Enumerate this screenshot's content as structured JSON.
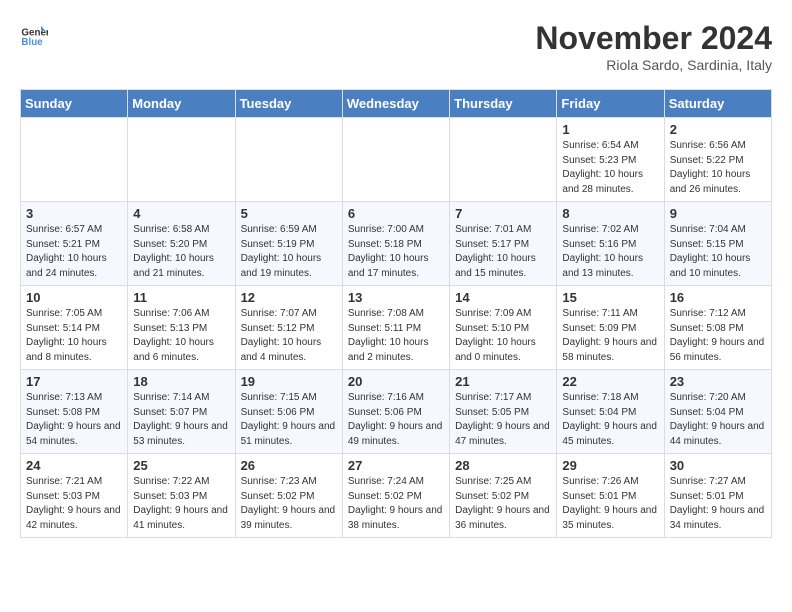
{
  "header": {
    "logo_line1": "General",
    "logo_line2": "Blue",
    "month_year": "November 2024",
    "location": "Riola Sardo, Sardinia, Italy"
  },
  "weekdays": [
    "Sunday",
    "Monday",
    "Tuesday",
    "Wednesday",
    "Thursday",
    "Friday",
    "Saturday"
  ],
  "weeks": [
    [
      {
        "day": "",
        "info": ""
      },
      {
        "day": "",
        "info": ""
      },
      {
        "day": "",
        "info": ""
      },
      {
        "day": "",
        "info": ""
      },
      {
        "day": "",
        "info": ""
      },
      {
        "day": "1",
        "info": "Sunrise: 6:54 AM\nSunset: 5:23 PM\nDaylight: 10 hours and 28 minutes."
      },
      {
        "day": "2",
        "info": "Sunrise: 6:56 AM\nSunset: 5:22 PM\nDaylight: 10 hours and 26 minutes."
      }
    ],
    [
      {
        "day": "3",
        "info": "Sunrise: 6:57 AM\nSunset: 5:21 PM\nDaylight: 10 hours and 24 minutes."
      },
      {
        "day": "4",
        "info": "Sunrise: 6:58 AM\nSunset: 5:20 PM\nDaylight: 10 hours and 21 minutes."
      },
      {
        "day": "5",
        "info": "Sunrise: 6:59 AM\nSunset: 5:19 PM\nDaylight: 10 hours and 19 minutes."
      },
      {
        "day": "6",
        "info": "Sunrise: 7:00 AM\nSunset: 5:18 PM\nDaylight: 10 hours and 17 minutes."
      },
      {
        "day": "7",
        "info": "Sunrise: 7:01 AM\nSunset: 5:17 PM\nDaylight: 10 hours and 15 minutes."
      },
      {
        "day": "8",
        "info": "Sunrise: 7:02 AM\nSunset: 5:16 PM\nDaylight: 10 hours and 13 minutes."
      },
      {
        "day": "9",
        "info": "Sunrise: 7:04 AM\nSunset: 5:15 PM\nDaylight: 10 hours and 10 minutes."
      }
    ],
    [
      {
        "day": "10",
        "info": "Sunrise: 7:05 AM\nSunset: 5:14 PM\nDaylight: 10 hours and 8 minutes."
      },
      {
        "day": "11",
        "info": "Sunrise: 7:06 AM\nSunset: 5:13 PM\nDaylight: 10 hours and 6 minutes."
      },
      {
        "day": "12",
        "info": "Sunrise: 7:07 AM\nSunset: 5:12 PM\nDaylight: 10 hours and 4 minutes."
      },
      {
        "day": "13",
        "info": "Sunrise: 7:08 AM\nSunset: 5:11 PM\nDaylight: 10 hours and 2 minutes."
      },
      {
        "day": "14",
        "info": "Sunrise: 7:09 AM\nSunset: 5:10 PM\nDaylight: 10 hours and 0 minutes."
      },
      {
        "day": "15",
        "info": "Sunrise: 7:11 AM\nSunset: 5:09 PM\nDaylight: 9 hours and 58 minutes."
      },
      {
        "day": "16",
        "info": "Sunrise: 7:12 AM\nSunset: 5:08 PM\nDaylight: 9 hours and 56 minutes."
      }
    ],
    [
      {
        "day": "17",
        "info": "Sunrise: 7:13 AM\nSunset: 5:08 PM\nDaylight: 9 hours and 54 minutes."
      },
      {
        "day": "18",
        "info": "Sunrise: 7:14 AM\nSunset: 5:07 PM\nDaylight: 9 hours and 53 minutes."
      },
      {
        "day": "19",
        "info": "Sunrise: 7:15 AM\nSunset: 5:06 PM\nDaylight: 9 hours and 51 minutes."
      },
      {
        "day": "20",
        "info": "Sunrise: 7:16 AM\nSunset: 5:06 PM\nDaylight: 9 hours and 49 minutes."
      },
      {
        "day": "21",
        "info": "Sunrise: 7:17 AM\nSunset: 5:05 PM\nDaylight: 9 hours and 47 minutes."
      },
      {
        "day": "22",
        "info": "Sunrise: 7:18 AM\nSunset: 5:04 PM\nDaylight: 9 hours and 45 minutes."
      },
      {
        "day": "23",
        "info": "Sunrise: 7:20 AM\nSunset: 5:04 PM\nDaylight: 9 hours and 44 minutes."
      }
    ],
    [
      {
        "day": "24",
        "info": "Sunrise: 7:21 AM\nSunset: 5:03 PM\nDaylight: 9 hours and 42 minutes."
      },
      {
        "day": "25",
        "info": "Sunrise: 7:22 AM\nSunset: 5:03 PM\nDaylight: 9 hours and 41 minutes."
      },
      {
        "day": "26",
        "info": "Sunrise: 7:23 AM\nSunset: 5:02 PM\nDaylight: 9 hours and 39 minutes."
      },
      {
        "day": "27",
        "info": "Sunrise: 7:24 AM\nSunset: 5:02 PM\nDaylight: 9 hours and 38 minutes."
      },
      {
        "day": "28",
        "info": "Sunrise: 7:25 AM\nSunset: 5:02 PM\nDaylight: 9 hours and 36 minutes."
      },
      {
        "day": "29",
        "info": "Sunrise: 7:26 AM\nSunset: 5:01 PM\nDaylight: 9 hours and 35 minutes."
      },
      {
        "day": "30",
        "info": "Sunrise: 7:27 AM\nSunset: 5:01 PM\nDaylight: 9 hours and 34 minutes."
      }
    ]
  ]
}
